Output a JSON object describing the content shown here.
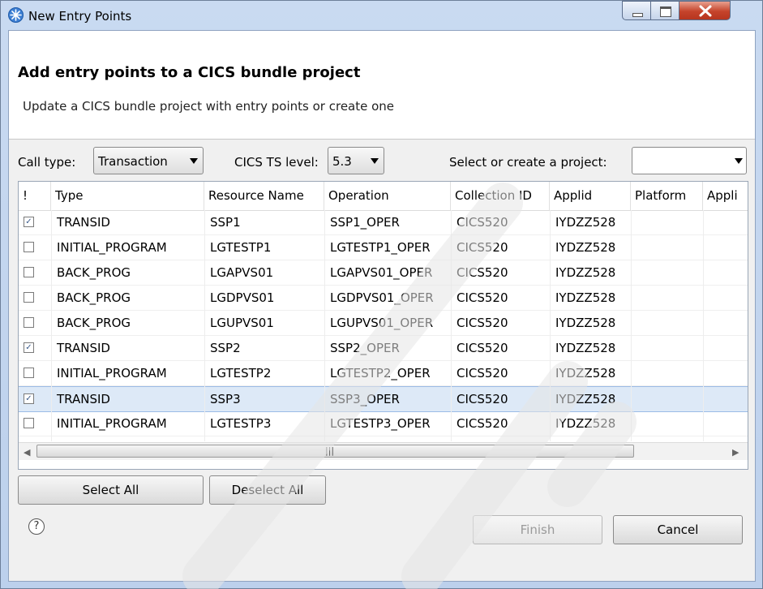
{
  "window": {
    "title": "New Entry Points"
  },
  "header": {
    "title": "Add entry points to a CICS bundle project",
    "subtitle": "Update a CICS bundle project with entry points or create one"
  },
  "controls": {
    "call_type_label": "Call type:",
    "call_type_value": "Transaction",
    "level_label": "CICS TS level:",
    "level_value": "5.3",
    "project_label": "Select or create a project:",
    "project_value": ""
  },
  "table": {
    "columns": [
      "!",
      "Type",
      "Resource Name",
      "Operation",
      "Collection ID",
      "Applid",
      "Platform",
      "Appli"
    ],
    "rows": [
      {
        "checked": true,
        "type": "TRANSID",
        "resource": "SSP1",
        "operation": "SSP1_OPER",
        "collection": "CICS520",
        "applid": "IYDZZ528"
      },
      {
        "checked": false,
        "type": "INITIAL_PROGRAM",
        "resource": "LGTESTP1",
        "operation": "LGTESTP1_OPER",
        "collection": "CICS520",
        "applid": "IYDZZ528"
      },
      {
        "checked": false,
        "type": "BACK_PROG",
        "resource": "LGAPVS01",
        "operation": "LGAPVS01_OPER",
        "collection": "CICS520",
        "applid": "IYDZZ528"
      },
      {
        "checked": false,
        "type": "BACK_PROG",
        "resource": "LGDPVS01",
        "operation": "LGDPVS01_OPER",
        "collection": "CICS520",
        "applid": "IYDZZ528"
      },
      {
        "checked": false,
        "type": "BACK_PROG",
        "resource": "LGUPVS01",
        "operation": "LGUPVS01_OPER",
        "collection": "CICS520",
        "applid": "IYDZZ528"
      },
      {
        "checked": true,
        "type": "TRANSID",
        "resource": "SSP2",
        "operation": "SSP2_OPER",
        "collection": "CICS520",
        "applid": "IYDZZ528"
      },
      {
        "checked": false,
        "type": "INITIAL_PROGRAM",
        "resource": "LGTESTP2",
        "operation": "LGTESTP2_OPER",
        "collection": "CICS520",
        "applid": "IYDZZ528"
      },
      {
        "checked": true,
        "type": "TRANSID",
        "resource": "SSP3",
        "operation": "SSP3_OPER",
        "collection": "CICS520",
        "applid": "IYDZZ528"
      },
      {
        "checked": false,
        "type": "INITIAL_PROGRAM",
        "resource": "LGTESTP3",
        "operation": "LGTESTP3_OPER",
        "collection": "CICS520",
        "applid": "IYDZZ528"
      }
    ]
  },
  "buttons": {
    "select_all": "Select All",
    "deselect_all": "Deselect All",
    "finish": "Finish",
    "cancel": "Cancel"
  },
  "help_glyph": "?"
}
